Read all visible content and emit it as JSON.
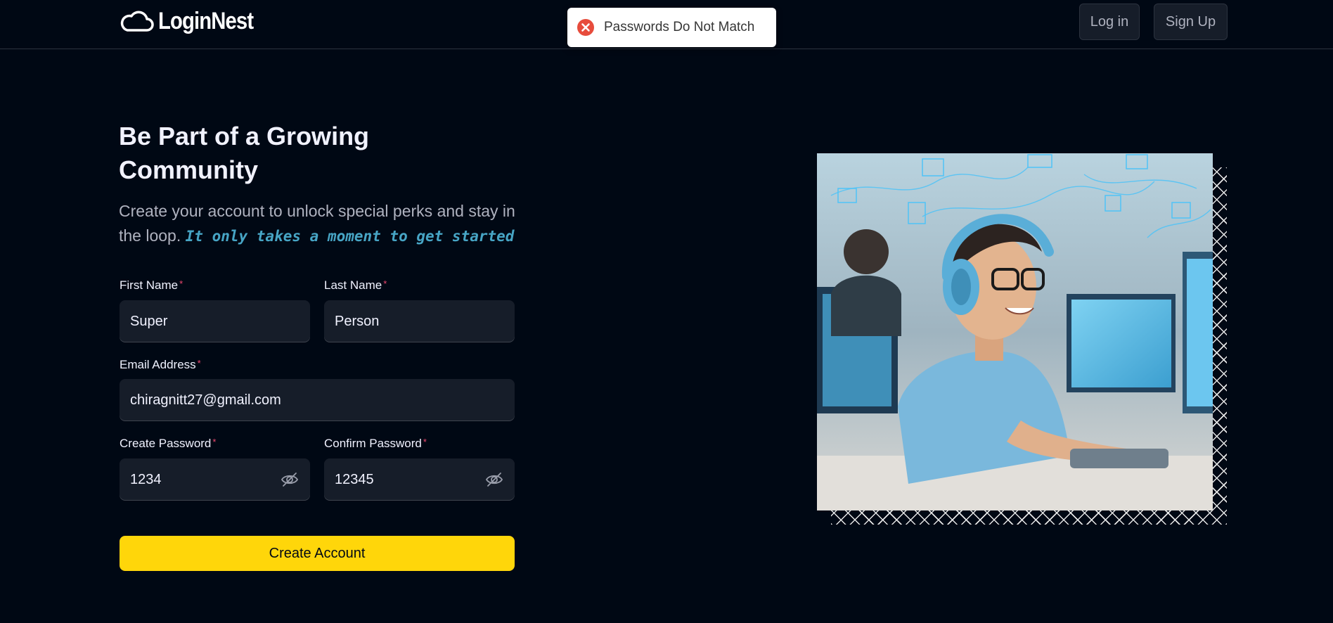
{
  "brand": {
    "name": "LoginNest"
  },
  "nav": {
    "login_label": "Log in",
    "signup_label": "Sign Up"
  },
  "toast": {
    "message": "Passwords Do Not Match",
    "icon": "error-circle-icon",
    "color": "#e74c3c"
  },
  "hero": {
    "title": "Be Part of a Growing Community",
    "subtitle": "Create your account to unlock special perks and stay in the loop.",
    "highlight": "It only takes a moment to get started"
  },
  "form": {
    "first_name": {
      "label": "First Name",
      "value": "Super"
    },
    "last_name": {
      "label": "Last Name",
      "value": "Person"
    },
    "email": {
      "label": "Email Address",
      "value": "chiragnitt27@gmail.com"
    },
    "password": {
      "label": "Create Password",
      "value": "1234",
      "icon": "eye-off-icon"
    },
    "confirm_password": {
      "label": "Confirm Password",
      "value": "12345",
      "icon": "eye-off-icon"
    },
    "required_marker": "*",
    "submit_label": "Create Account"
  },
  "colors": {
    "background": "#000814",
    "accent": "#ffd60a",
    "field_bg": "#161d29",
    "highlight": "#47a5c5",
    "required": "#ef476f"
  }
}
